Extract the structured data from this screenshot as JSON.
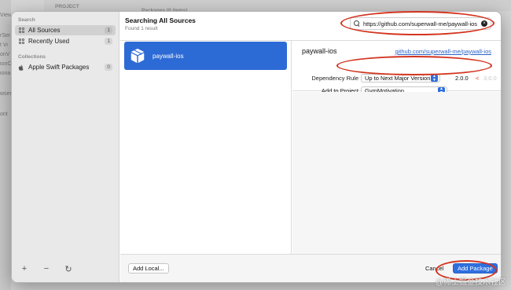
{
  "background": {
    "side_fragments": [
      "View",
      "rSer",
      "t Vi",
      "onV",
      "ionC",
      "iona",
      "wser",
      "ont"
    ],
    "project_label": "PROJECT",
    "packages_label": "Packages (0 items)"
  },
  "sidebar": {
    "search_section": "Search",
    "collections_section": "Collections",
    "items": [
      {
        "label": "All Sources",
        "count": "1",
        "icon": "grid-icon",
        "selected": true
      },
      {
        "label": "Recently Used",
        "count": "1",
        "icon": "grid-icon",
        "selected": false
      },
      {
        "label": "Apple Swift Packages",
        "count": "0",
        "icon": "apple-icon",
        "selected": false
      }
    ],
    "tools": [
      "+",
      "−",
      "↻"
    ]
  },
  "header": {
    "title": "Searching All Sources",
    "subtitle": "Found 1 result",
    "search_value": "https://github.com/superwall-me/paywall-ios",
    "clear_icon": "×"
  },
  "results": [
    {
      "name": "paywall-ios",
      "icon": "package-icon"
    }
  ],
  "detail": {
    "package_name": "paywall-ios",
    "link": "github.com/superwall-me/paywall-ios",
    "dependency_rule_label": "Dependency Rule",
    "dependency_rule_value": "Up to Next Major Version",
    "version_min": "2.0.0",
    "version_lt": "<",
    "version_max": "3.0.0",
    "add_to_project_label": "Add to Project",
    "add_to_project_value": "GymMotivation"
  },
  "footer": {
    "add_local": "Add Local...",
    "cancel": "Cancel",
    "add_package": "Add Package"
  },
  "watermark": "@稀土掘金技术社区",
  "colors": {
    "accent": "#2f6fde",
    "annotation": "#d3341f",
    "selected_result": "#2c6ad6"
  }
}
